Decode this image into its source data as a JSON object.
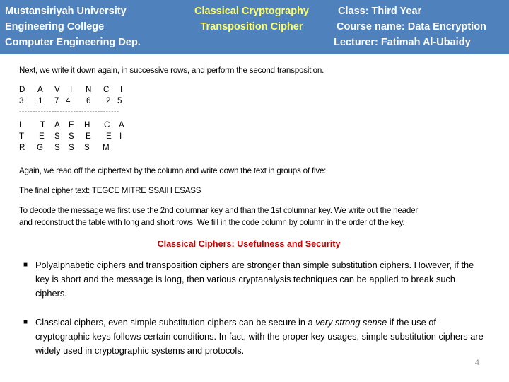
{
  "header": {
    "left": [
      "Mustansiriyah University",
      "Engineering College",
      "Computer Engineering Dep."
    ],
    "center": [
      "Classical Cryptography",
      "Transposition Cipher"
    ],
    "right": [
      "Class: Third Year",
      "Course name: Data Encryption",
      "Lecturer: Fatimah Al-Ubaidy"
    ]
  },
  "colors": {
    "header_bg": "#4f81bd",
    "header_accent": "#ffff66",
    "section_title": "#c00000"
  },
  "intro": "Next, we write it down again, in successive rows, and perform the second transposition.",
  "table": {
    "key_letters": [
      "D",
      "A",
      "V",
      "I",
      "N",
      "C",
      "I"
    ],
    "key_numbers": [
      "3",
      "1",
      "7",
      "4",
      "6",
      "2",
      "5"
    ],
    "separator": "-------------------------------------",
    "rows": [
      [
        "I",
        "T",
        "A",
        "E",
        "H",
        "C",
        "A"
      ],
      [
        "T",
        "E",
        "S",
        "S",
        "E",
        "E",
        "I"
      ],
      [
        "R",
        "G",
        "S",
        "S",
        "S",
        "M",
        ""
      ]
    ]
  },
  "read_off": "Again, we read off the ciphertext by the column and write down the text in groups of five:",
  "final_cipher": "The final cipher text: TEGCE MITRE SSAIH ESASS",
  "decode": [
    "To decode the message we first use the 2nd columnar key and than the 1st columnar key. We write out the header",
    "and reconstruct the table with long and short rows. We fill in the code column by column in the order of the key."
  ],
  "section_title": "Classical Ciphers: Usefulness and Security",
  "bullets": [
    {
      "before": "Polyalphabetic ciphers and transposition ciphers are stronger than simple substitution ciphers. However, if the key is short and the message is long, then various cryptanalysis techniques can be applied to break such ciphers.",
      "emphasis": "",
      "after": ""
    },
    {
      "before": "Classical ciphers, even simple substitution ciphers can be secure in a ",
      "emphasis": "very strong sense",
      "after": " if the use of cryptographic keys follows certain conditions. In fact, with the proper key usages, simple substitution ciphers are widely used in cryptographic systems and protocols."
    }
  ],
  "bullet_mark": "■",
  "page_number": "4"
}
